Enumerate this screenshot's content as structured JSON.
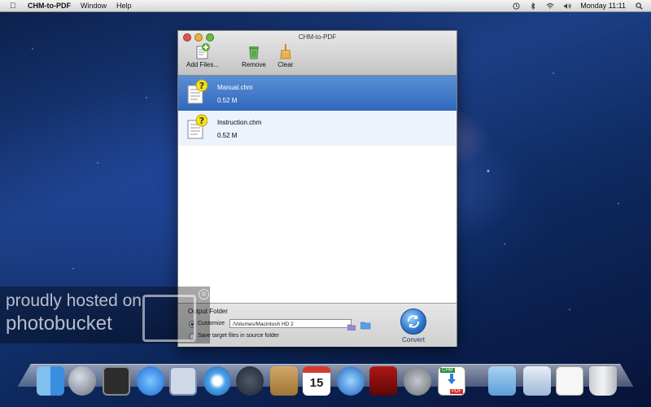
{
  "menubar": {
    "app_name": "CHM-to-PDF",
    "menus": [
      "Window",
      "Help"
    ],
    "clock": "Monday 11:11",
    "status_icons": [
      "time-machine-icon",
      "bluetooth-icon",
      "wifi-icon",
      "volume-icon",
      "search-icon"
    ]
  },
  "window": {
    "title": "CHM-to-PDF",
    "toolbar": {
      "add_label": "Add Files...",
      "remove_label": "Remove",
      "clear_label": "Clear"
    },
    "files": [
      {
        "name": "Manual.chm",
        "size": "0.52 M",
        "selected": true
      },
      {
        "name": "Instruction.chm",
        "size": "0.52 M",
        "selected": false
      }
    ],
    "output": {
      "label": "Output Folder",
      "customize_label": "Customize",
      "path": "/Volumes/Macintosh HD 2",
      "source_label": "Save target files in source folder",
      "convert_label": "Convert"
    }
  },
  "watermark": {
    "line1": "proudly hosted on",
    "line2": "photobucket",
    "reg": "®"
  },
  "dock": {
    "icons": [
      "finder-icon",
      "launchpad-icon",
      "mission-control-icon",
      "app-store-icon",
      "mail-icon",
      "safari-icon",
      "facetime-icon",
      "address-book-icon",
      "ical-icon",
      "itunes-icon",
      "photo-booth-icon",
      "system-preferences-icon",
      "chm-to-pdf-icon",
      "applications-folder-icon",
      "downloads-folder-icon",
      "documents-icon",
      "trash-icon"
    ],
    "ical_day": "15",
    "chm_label": "CHM",
    "pdf_label": "PDF"
  }
}
